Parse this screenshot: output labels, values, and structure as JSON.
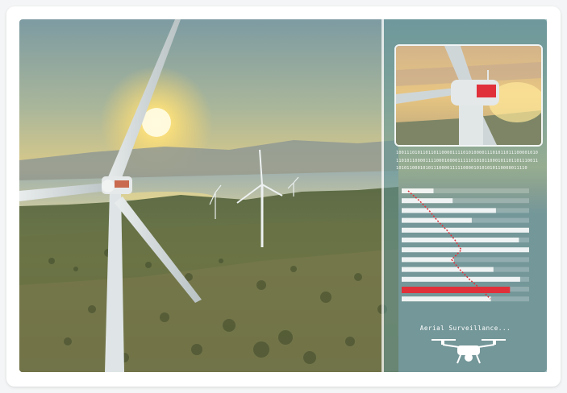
{
  "hud": {
    "caption": "Aerial Surveillance...",
    "binary_lines": [
      "1001110101101101100001111010100001110101101110000101011",
      "1101011000011110001000011111010101100010110110111001101",
      "1010110001010111000011111000010101010110000011110"
    ],
    "bars": [
      {
        "value": 0.25,
        "highlight": false
      },
      {
        "value": 0.4,
        "highlight": false
      },
      {
        "value": 0.74,
        "highlight": false
      },
      {
        "value": 0.55,
        "highlight": false
      },
      {
        "value": 1.0,
        "highlight": false
      },
      {
        "value": 0.92,
        "highlight": false
      },
      {
        "value": 1.0,
        "highlight": false
      },
      {
        "value": 0.41,
        "highlight": false
      },
      {
        "value": 0.72,
        "highlight": false
      },
      {
        "value": 0.93,
        "highlight": false
      },
      {
        "value": 0.85,
        "highlight": true
      },
      {
        "value": 0.7,
        "highlight": false
      }
    ],
    "colors": {
      "accent": "#e0303a",
      "bar": "#ffffff"
    }
  },
  "icons": {
    "drone": "drone-icon"
  }
}
